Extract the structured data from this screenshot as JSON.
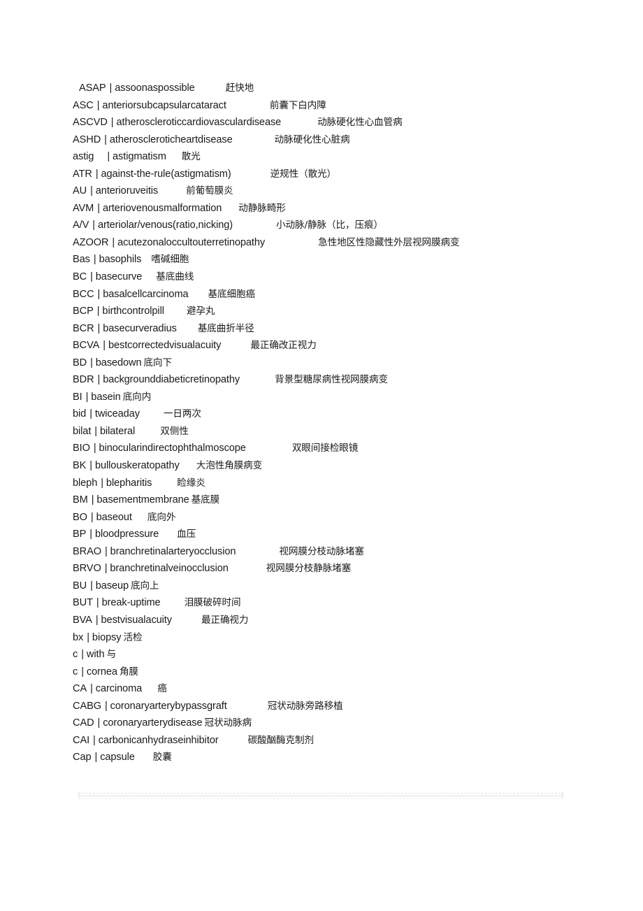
{
  "document": {
    "background_color": "#ffffff",
    "text_color": "#1a1a1a",
    "separator": "|",
    "divider": {
      "name": "decorative-horizontal-rule",
      "colors": [
        "#e3dce6",
        "#dfe0e0",
        "#d9f0f4"
      ]
    }
  },
  "entries": [
    {
      "abbr": "ASAP",
      "term": "assoonaspossible",
      "cn": "赶快地",
      "gap": 44,
      "indent": true
    },
    {
      "abbr": "ASC",
      "term": "anteriorsubcapsularcataract",
      "cn": "前囊下白内障",
      "gap": 62,
      "indent": false
    },
    {
      "abbr": "ASCVD",
      "term": "atheroscleroticcardiovasculardisease",
      "cn": "动脉硬化性心血管病",
      "gap": 52,
      "indent": false
    },
    {
      "abbr": "ASHD",
      "term": "atheroscleroticheartdisease",
      "cn": "动脉硬化性心脏病",
      "gap": 60,
      "indent": false
    },
    {
      "abbr": "astig",
      "term": "astigmatism",
      "cn": "散光",
      "gap": 22,
      "indent": false,
      "abbr_pad": 14
    },
    {
      "abbr": "ATR",
      "term": "against-the-rule(astigmatism)",
      "cn": "逆规性（散光）",
      "gap": 56,
      "indent": false
    },
    {
      "abbr": "AU",
      "term": "anterioruveitis",
      "cn": "前葡萄膜炎",
      "gap": 40,
      "indent": false
    },
    {
      "abbr": "AVM",
      "term": "arteriovenousmalformation",
      "cn": "动静脉畸形",
      "gap": 24,
      "indent": false
    },
    {
      "abbr": "A/V",
      "term": "arteriolar/venous(ratio,nicking)",
      "cn": "小动脉/静脉（比，压痕）",
      "gap": 62,
      "indent": false
    },
    {
      "abbr": "AZOOR",
      "term": "acutezonaloccultouterretinopathy",
      "cn": "急性地区性隐藏性外层视网膜病变",
      "gap": 76,
      "indent": false
    },
    {
      "abbr": "Bas",
      "term": "basophils",
      "cn": "嗜碱细胞",
      "gap": 14,
      "indent": false
    },
    {
      "abbr": "BC",
      "term": "basecurve",
      "cn": "基底曲线",
      "gap": 20,
      "indent": false
    },
    {
      "abbr": "BCC",
      "term": "basalcellcarcinoma",
      "cn": "基底细胞癌",
      "gap": 28,
      "indent": false
    },
    {
      "abbr": "BCP",
      "term": "birthcontrolpill",
      "cn": "避孕丸",
      "gap": 32,
      "indent": false
    },
    {
      "abbr": "BCR",
      "term": "basecurveradius",
      "cn": "基底曲折半径",
      "gap": 30,
      "indent": false
    },
    {
      "abbr": "BCVA",
      "term": "bestcorrectedvisualacuity",
      "cn": "最正确改正视力",
      "gap": 42,
      "indent": false
    },
    {
      "abbr": "BD",
      "term": "basedown",
      "cn": "底向下",
      "gap": 3,
      "indent": false
    },
    {
      "abbr": "BDR",
      "term": "backgrounddiabeticretinopathy",
      "cn": "背景型糖尿病性视网膜病变",
      "gap": 50,
      "indent": false
    },
    {
      "abbr": "BI",
      "term": "basein",
      "cn": "底向内",
      "gap": 3,
      "indent": false
    },
    {
      "abbr": "bid",
      "term": "twiceaday",
      "cn": "一日两次",
      "gap": 34,
      "indent": false
    },
    {
      "abbr": "bilat",
      "term": "bilateral",
      "cn": "双侧性",
      "gap": 36,
      "indent": false
    },
    {
      "abbr": "BIO",
      "term": "binocularindirectophthalmoscope",
      "cn": "双眼间接检眼镜",
      "gap": 66,
      "indent": false
    },
    {
      "abbr": "BK",
      "term": "bullouskeratopathy",
      "cn": "大泡性角膜病变",
      "gap": 24,
      "indent": false
    },
    {
      "abbr": "bleph",
      "term": "blepharitis",
      "cn": "睑缘炎",
      "gap": 36,
      "indent": false
    },
    {
      "abbr": "BM",
      "term": "basementmembrane",
      "cn": "基底膜",
      "gap": 3,
      "indent": false
    },
    {
      "abbr": "BO",
      "term": "baseout",
      "cn": "底向外",
      "gap": 22,
      "indent": false
    },
    {
      "abbr": "BP",
      "term": "bloodpressure",
      "cn": "血压",
      "gap": 26,
      "indent": false
    },
    {
      "abbr": "BRAO",
      "term": "branchretinalarteryocclusion",
      "cn": "视网膜分枝动脉堵塞",
      "gap": 62,
      "indent": false
    },
    {
      "abbr": "BRVO",
      "term": "branchretinalveinocclusion",
      "cn": "视网膜分枝静脉堵塞",
      "gap": 54,
      "indent": false
    },
    {
      "abbr": "BU",
      "term": "baseup",
      "cn": "底向上",
      "gap": 3,
      "indent": false
    },
    {
      "abbr": "BUT",
      "term": "break-uptime",
      "cn": "泪膜破碎时间",
      "gap": 34,
      "indent": false
    },
    {
      "abbr": "BVA",
      "term": "bestvisualacuity",
      "cn": "最正确视力",
      "gap": 42,
      "indent": false
    },
    {
      "abbr": "bx",
      "term": "biopsy",
      "cn": "活检",
      "gap": 3,
      "indent": false
    },
    {
      "abbr": "c",
      "term": "with",
      "cn": "与",
      "gap": 3,
      "indent": false
    },
    {
      "abbr": "c",
      "term": "cornea",
      "cn": "角膜",
      "gap": 3,
      "indent": false
    },
    {
      "abbr": "CA",
      "term": "carcinoma",
      "cn": "癌",
      "gap": 22,
      "indent": false
    },
    {
      "abbr": "CABG",
      "term": "coronaryarterybypassgraft",
      "cn": "冠状动脉旁路移植",
      "gap": 58,
      "indent": false
    },
    {
      "abbr": "CAD",
      "term": "coronaryarterydisease",
      "cn": "冠状动脉病",
      "gap": 3,
      "indent": false
    },
    {
      "abbr": "CAI",
      "term": "carbonicanhydraseinhibitor",
      "cn": "碳酸酗酶克制剂",
      "gap": 42,
      "indent": false
    },
    {
      "abbr": "Cap",
      "term": "capsule",
      "cn": "胶囊",
      "gap": 26,
      "indent": false
    }
  ]
}
